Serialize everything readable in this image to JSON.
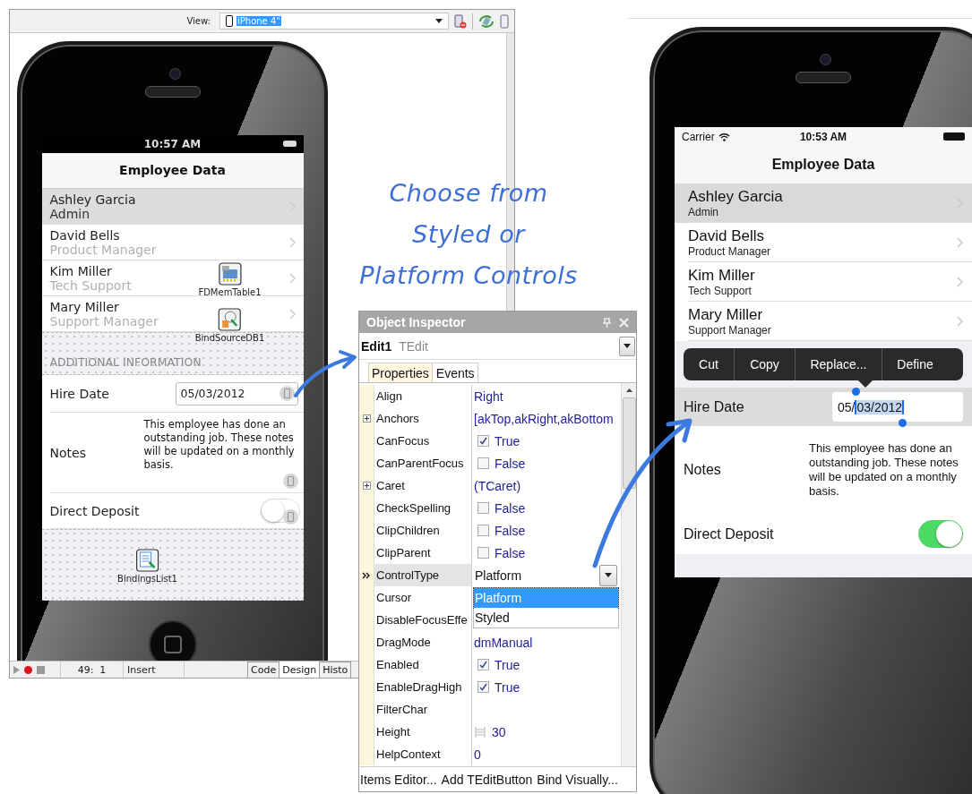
{
  "ide": {
    "view_label": "View:",
    "view_value": "iPhone 4\""
  },
  "design_phone": {
    "time": "10:57 AM",
    "title": "Employee Data",
    "employees": [
      {
        "name": "Ashley Garcia",
        "role": "Admin",
        "selected": true
      },
      {
        "name": "David Bells",
        "role": "Product Manager",
        "selected": false
      },
      {
        "name": "Kim Miller",
        "role": "Tech Support",
        "selected": false
      },
      {
        "name": "Mary Miller",
        "role": "Support Manager",
        "selected": false
      }
    ],
    "components": [
      {
        "label": "FDMemTable1",
        "kind": "table"
      },
      {
        "label": "BindSourceDB1",
        "kind": "bindsource"
      },
      {
        "label": "BindingsList1",
        "kind": "bindings"
      }
    ],
    "section_header": "ADDITIONAL INFORMATION",
    "hire_date": {
      "label": "Hire Date",
      "value": "05/03/2012"
    },
    "notes": {
      "label": "Notes",
      "text": "This employee has done an outstanding job. These notes will be updated on a monthly basis."
    },
    "direct_deposit": {
      "label": "Direct Deposit",
      "on": false
    }
  },
  "status_bar": {
    "position": "49:  1",
    "mode": "Insert",
    "tabs": [
      {
        "label": "Code",
        "selected": false
      },
      {
        "label": "Design",
        "selected": true
      },
      {
        "label": "Histo",
        "selected": false
      }
    ]
  },
  "caption": [
    "Choose from",
    "Styled or",
    "Platform Controls"
  ],
  "inspector": {
    "title": "Object Inspector",
    "object_name": "Edit1",
    "object_type": "TEdit",
    "tabs": [
      {
        "label": "Properties",
        "selected": true
      },
      {
        "label": "Events",
        "selected": false
      }
    ],
    "properties": [
      {
        "name": "Align",
        "kind": "text",
        "value": "Right",
        "expandable": false,
        "selected": false
      },
      {
        "name": "Anchors",
        "kind": "text",
        "value": "[akTop,akRight,akBottom",
        "expandable": true,
        "selected": false
      },
      {
        "name": "CanFocus",
        "kind": "check",
        "value": "True",
        "checked": true,
        "expandable": false,
        "selected": false
      },
      {
        "name": "CanParentFocus",
        "kind": "check",
        "value": "False",
        "checked": false,
        "expandable": false,
        "selected": false
      },
      {
        "name": "Caret",
        "kind": "text",
        "value": "(TCaret)",
        "expandable": true,
        "selected": false
      },
      {
        "name": "CheckSpelling",
        "kind": "check",
        "value": "False",
        "checked": false,
        "expandable": false,
        "selected": false
      },
      {
        "name": "ClipChildren",
        "kind": "check",
        "value": "False",
        "checked": false,
        "expandable": false,
        "selected": false
      },
      {
        "name": "ClipParent",
        "kind": "check",
        "value": "False",
        "checked": false,
        "expandable": false,
        "selected": false
      },
      {
        "name": "ControlType",
        "kind": "dropdown",
        "value": "Platform",
        "expandable": false,
        "selected": true
      },
      {
        "name": "Cursor",
        "kind": "blank",
        "expandable": false,
        "selected": false
      },
      {
        "name": "DisableFocusEffe",
        "kind": "blank",
        "expandable": false,
        "selected": false
      },
      {
        "name": "DragMode",
        "kind": "text",
        "value": "dmManual",
        "expandable": false,
        "selected": false
      },
      {
        "name": "Enabled",
        "kind": "check",
        "value": "True",
        "checked": true,
        "expandable": false,
        "selected": false
      },
      {
        "name": "EnableDragHigh",
        "kind": "check",
        "value": "True",
        "checked": true,
        "expandable": false,
        "selected": false
      },
      {
        "name": "FilterChar",
        "kind": "blank",
        "expandable": false,
        "selected": false
      },
      {
        "name": "Height",
        "kind": "size",
        "value": "30",
        "expandable": false,
        "selected": false
      },
      {
        "name": "HelpContext",
        "kind": "text",
        "value": "0",
        "expandable": false,
        "selected": false
      }
    ],
    "dropdown_options": [
      {
        "label": "Platform",
        "selected": true
      },
      {
        "label": "Styled",
        "selected": false
      }
    ],
    "actions": [
      "Items Editor...",
      "Add TEditButton",
      "Bind Visually..."
    ]
  },
  "device_phone": {
    "carrier": "Carrier",
    "time": "10:53 AM",
    "title": "Employee Data",
    "employees": [
      {
        "name": "Ashley Garcia",
        "role": "Admin",
        "selected": true
      },
      {
        "name": "David Bells",
        "role": "Product Manager",
        "selected": false
      },
      {
        "name": "Kim Miller",
        "role": "Tech Support",
        "selected": false
      },
      {
        "name": "Mary Miller",
        "role": "Support Manager",
        "selected": false
      }
    ],
    "edit_menu": [
      "Cut",
      "Copy",
      "Replace...",
      "Define"
    ],
    "hire_date": {
      "label": "Hire Date",
      "value_parts": [
        {
          "text": "05/",
          "selected": false
        },
        {
          "text": "03/2012",
          "selected": true
        }
      ]
    },
    "notes": {
      "label": "Notes",
      "text": "This employee has done an outstanding job. These notes will be updated on a monthly basis."
    },
    "direct_deposit": {
      "label": "Direct Deposit",
      "on": true
    }
  }
}
